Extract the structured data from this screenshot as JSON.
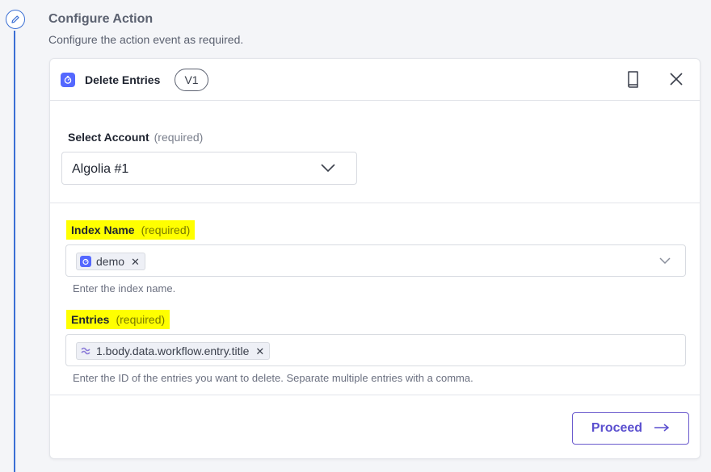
{
  "step": {
    "title": "Configure Action",
    "subtitle": "Configure the action event as required."
  },
  "card": {
    "title": "Delete Entries",
    "version": "V1",
    "app_icon": "stopwatch-icon",
    "accent": "#5468ff"
  },
  "account": {
    "label": "Select Account",
    "required": "(required)",
    "value": "Algolia #1"
  },
  "index_name": {
    "label": "Index Name",
    "required": "(required)",
    "token": "demo",
    "help": "Enter the index name."
  },
  "entries": {
    "label": "Entries",
    "required": "(required)",
    "token": "1.body.data.workflow.entry.title",
    "help": "Enter the ID of the entries you want to delete. Separate multiple entries with a comma."
  },
  "footer": {
    "proceed_label": "Proceed",
    "proceed_color": "#5a4fcf"
  },
  "highlight_color": "#ffff00"
}
